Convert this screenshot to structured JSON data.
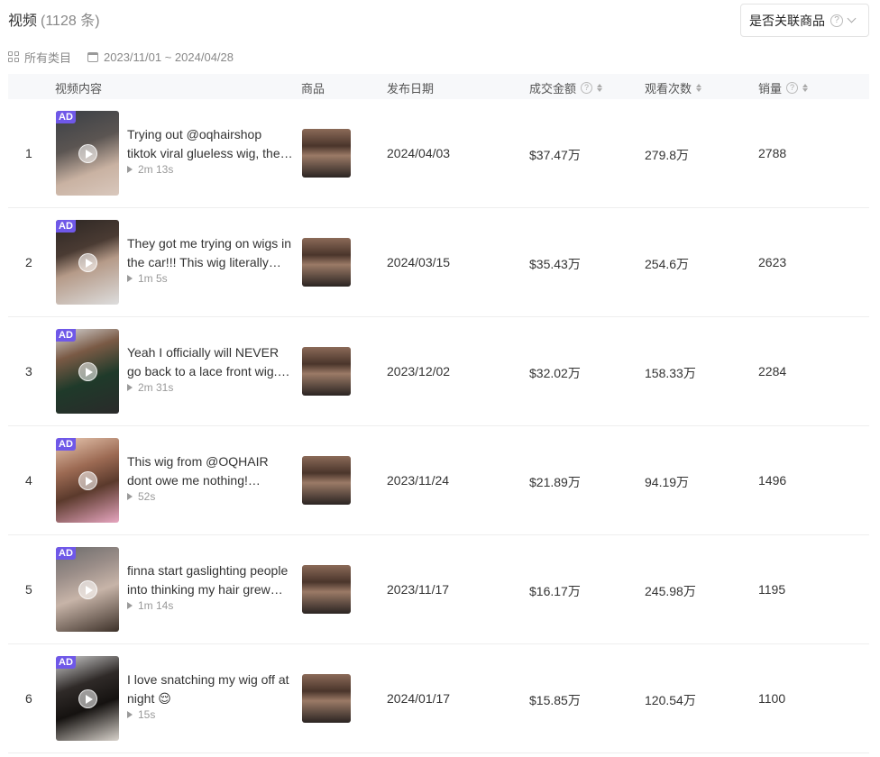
{
  "header": {
    "title": "视频",
    "count": "(1128 条)",
    "filter_label": "是否关联商品",
    "filter_help": "?"
  },
  "meta": {
    "category": "所有类目",
    "date_range": "2023/11/01 ~ 2024/04/28"
  },
  "table": {
    "columns": {
      "video": "视频内容",
      "product": "商品",
      "date": "发布日期",
      "gmv": "成交金额",
      "views": "观看次数",
      "sales": "销量"
    },
    "help_glyph": "?",
    "ad_label": "AD",
    "rows": [
      {
        "index": "1",
        "desc": "Trying out @oqhairshop tiktok viral glueless wig, the…",
        "duration": "2m 13s",
        "date": "2024/04/03",
        "gmv": "$37.47万",
        "views": "279.8万",
        "sales": "2788"
      },
      {
        "index": "2",
        "desc": "They got me trying on wigs in the car!!! This wig literally…",
        "duration": "1m 5s",
        "date": "2024/03/15",
        "gmv": "$35.43万",
        "views": "254.6万",
        "sales": "2623"
      },
      {
        "index": "3",
        "desc": "Yeah I officially will NEVER go back to a lace front wig.…",
        "duration": "2m 31s",
        "date": "2023/12/02",
        "gmv": "$32.02万",
        "views": "158.33万",
        "sales": "2284"
      },
      {
        "index": "4",
        "desc": "This wig from @OQHAIR dont owe me nothing!…",
        "duration": "52s",
        "date": "2023/11/24",
        "gmv": "$21.89万",
        "views": "94.19万",
        "sales": "1496"
      },
      {
        "index": "5",
        "desc": "finna start gaslighting people into thinking my hair grew…",
        "duration": "1m 14s",
        "date": "2023/11/17",
        "gmv": "$16.17万",
        "views": "245.98万",
        "sales": "1195"
      },
      {
        "index": "6",
        "desc": "I love snatching my wig off at night 😌",
        "duration": "15s",
        "date": "2024/01/17",
        "gmv": "$15.85万",
        "views": "120.54万",
        "sales": "1100"
      }
    ]
  }
}
